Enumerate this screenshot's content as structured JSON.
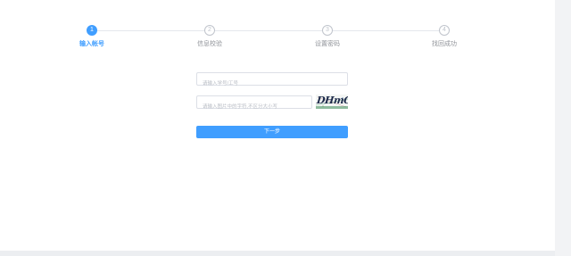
{
  "steps": [
    {
      "number": "1",
      "label": "输入帐号",
      "active": true
    },
    {
      "number": "2",
      "label": "信息校验",
      "active": false
    },
    {
      "number": "3",
      "label": "设置密码",
      "active": false
    },
    {
      "number": "4",
      "label": "找回成功",
      "active": false
    }
  ],
  "form": {
    "account_placeholder": "请输入学号/工号",
    "captcha_placeholder": "请输入图片中的字符,不区分大小写",
    "captcha_text": "DHmG",
    "next_label": "下一步"
  },
  "colors": {
    "accent": "#409eff",
    "inactive": "#c0c4cc"
  }
}
